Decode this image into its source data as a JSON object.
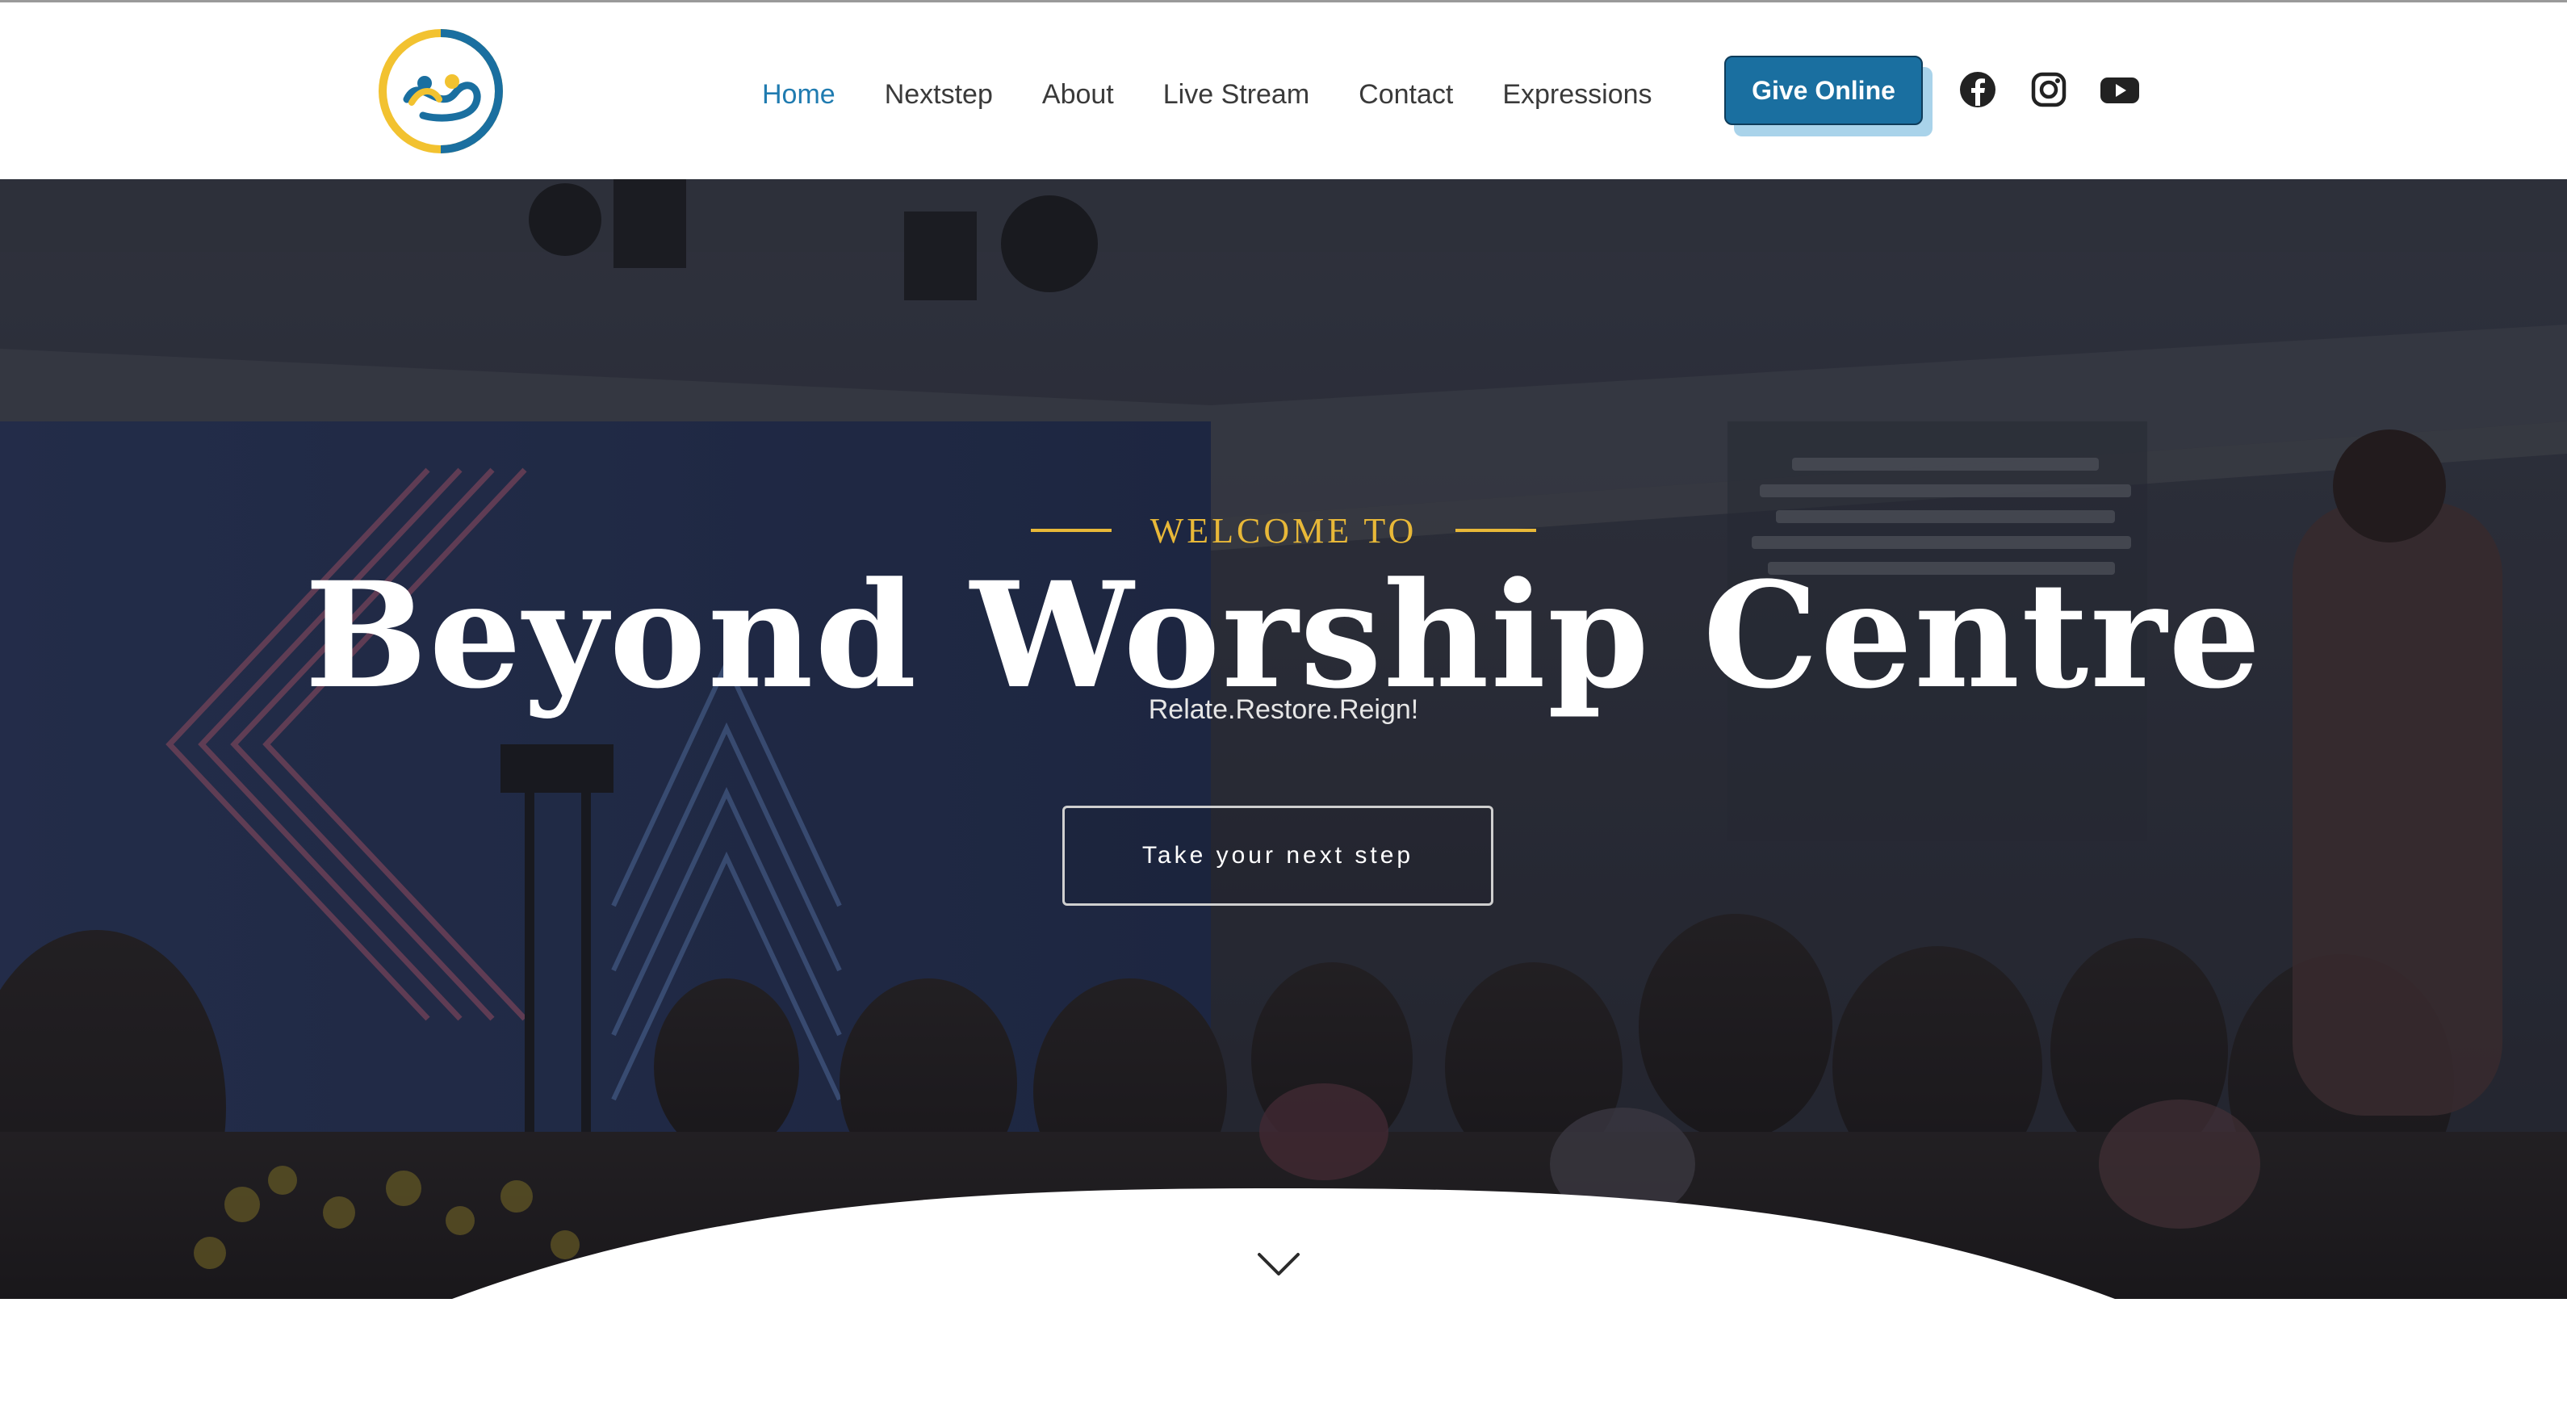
{
  "header": {
    "logo_name": "church-logo",
    "nav": [
      {
        "label": "Home",
        "active": true
      },
      {
        "label": "Nextstep",
        "active": false
      },
      {
        "label": "About",
        "active": false
      },
      {
        "label": "Live Stream",
        "active": false
      },
      {
        "label": "Contact",
        "active": false
      },
      {
        "label": "Expressions",
        "active": false
      }
    ],
    "give_button": "Give Online",
    "social_icons": [
      "facebook-icon",
      "instagram-icon",
      "youtube-icon"
    ]
  },
  "hero": {
    "eyebrow": "WELCOME TO",
    "title": "Beyond Worship Centre",
    "tagline": "Relate.Restore.Reign!",
    "cta": "Take your next step",
    "scroll_icon": "chevron-down-icon"
  },
  "colors": {
    "accent": "#1f7bb0",
    "button": "#1a6fa0",
    "gold": "#e8b838",
    "hero_overlay": "#262932"
  }
}
